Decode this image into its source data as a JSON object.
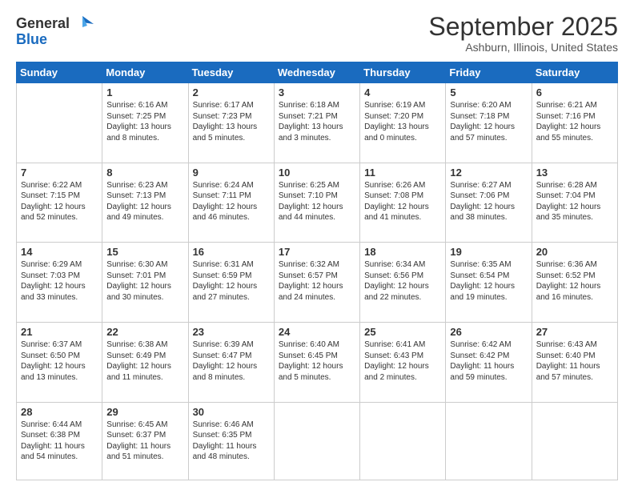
{
  "logo": {
    "general": "General",
    "blue": "Blue"
  },
  "header": {
    "title": "September 2025",
    "subtitle": "Ashburn, Illinois, United States"
  },
  "days_of_week": [
    "Sunday",
    "Monday",
    "Tuesday",
    "Wednesday",
    "Thursday",
    "Friday",
    "Saturday"
  ],
  "weeks": [
    [
      {
        "day": "",
        "info": ""
      },
      {
        "day": "1",
        "info": "Sunrise: 6:16 AM\nSunset: 7:25 PM\nDaylight: 13 hours\nand 8 minutes."
      },
      {
        "day": "2",
        "info": "Sunrise: 6:17 AM\nSunset: 7:23 PM\nDaylight: 13 hours\nand 5 minutes."
      },
      {
        "day": "3",
        "info": "Sunrise: 6:18 AM\nSunset: 7:21 PM\nDaylight: 13 hours\nand 3 minutes."
      },
      {
        "day": "4",
        "info": "Sunrise: 6:19 AM\nSunset: 7:20 PM\nDaylight: 13 hours\nand 0 minutes."
      },
      {
        "day": "5",
        "info": "Sunrise: 6:20 AM\nSunset: 7:18 PM\nDaylight: 12 hours\nand 57 minutes."
      },
      {
        "day": "6",
        "info": "Sunrise: 6:21 AM\nSunset: 7:16 PM\nDaylight: 12 hours\nand 55 minutes."
      }
    ],
    [
      {
        "day": "7",
        "info": "Sunrise: 6:22 AM\nSunset: 7:15 PM\nDaylight: 12 hours\nand 52 minutes."
      },
      {
        "day": "8",
        "info": "Sunrise: 6:23 AM\nSunset: 7:13 PM\nDaylight: 12 hours\nand 49 minutes."
      },
      {
        "day": "9",
        "info": "Sunrise: 6:24 AM\nSunset: 7:11 PM\nDaylight: 12 hours\nand 46 minutes."
      },
      {
        "day": "10",
        "info": "Sunrise: 6:25 AM\nSunset: 7:10 PM\nDaylight: 12 hours\nand 44 minutes."
      },
      {
        "day": "11",
        "info": "Sunrise: 6:26 AM\nSunset: 7:08 PM\nDaylight: 12 hours\nand 41 minutes."
      },
      {
        "day": "12",
        "info": "Sunrise: 6:27 AM\nSunset: 7:06 PM\nDaylight: 12 hours\nand 38 minutes."
      },
      {
        "day": "13",
        "info": "Sunrise: 6:28 AM\nSunset: 7:04 PM\nDaylight: 12 hours\nand 35 minutes."
      }
    ],
    [
      {
        "day": "14",
        "info": "Sunrise: 6:29 AM\nSunset: 7:03 PM\nDaylight: 12 hours\nand 33 minutes."
      },
      {
        "day": "15",
        "info": "Sunrise: 6:30 AM\nSunset: 7:01 PM\nDaylight: 12 hours\nand 30 minutes."
      },
      {
        "day": "16",
        "info": "Sunrise: 6:31 AM\nSunset: 6:59 PM\nDaylight: 12 hours\nand 27 minutes."
      },
      {
        "day": "17",
        "info": "Sunrise: 6:32 AM\nSunset: 6:57 PM\nDaylight: 12 hours\nand 24 minutes."
      },
      {
        "day": "18",
        "info": "Sunrise: 6:34 AM\nSunset: 6:56 PM\nDaylight: 12 hours\nand 22 minutes."
      },
      {
        "day": "19",
        "info": "Sunrise: 6:35 AM\nSunset: 6:54 PM\nDaylight: 12 hours\nand 19 minutes."
      },
      {
        "day": "20",
        "info": "Sunrise: 6:36 AM\nSunset: 6:52 PM\nDaylight: 12 hours\nand 16 minutes."
      }
    ],
    [
      {
        "day": "21",
        "info": "Sunrise: 6:37 AM\nSunset: 6:50 PM\nDaylight: 12 hours\nand 13 minutes."
      },
      {
        "day": "22",
        "info": "Sunrise: 6:38 AM\nSunset: 6:49 PM\nDaylight: 12 hours\nand 11 minutes."
      },
      {
        "day": "23",
        "info": "Sunrise: 6:39 AM\nSunset: 6:47 PM\nDaylight: 12 hours\nand 8 minutes."
      },
      {
        "day": "24",
        "info": "Sunrise: 6:40 AM\nSunset: 6:45 PM\nDaylight: 12 hours\nand 5 minutes."
      },
      {
        "day": "25",
        "info": "Sunrise: 6:41 AM\nSunset: 6:43 PM\nDaylight: 12 hours\nand 2 minutes."
      },
      {
        "day": "26",
        "info": "Sunrise: 6:42 AM\nSunset: 6:42 PM\nDaylight: 11 hours\nand 59 minutes."
      },
      {
        "day": "27",
        "info": "Sunrise: 6:43 AM\nSunset: 6:40 PM\nDaylight: 11 hours\nand 57 minutes."
      }
    ],
    [
      {
        "day": "28",
        "info": "Sunrise: 6:44 AM\nSunset: 6:38 PM\nDaylight: 11 hours\nand 54 minutes."
      },
      {
        "day": "29",
        "info": "Sunrise: 6:45 AM\nSunset: 6:37 PM\nDaylight: 11 hours\nand 51 minutes."
      },
      {
        "day": "30",
        "info": "Sunrise: 6:46 AM\nSunset: 6:35 PM\nDaylight: 11 hours\nand 48 minutes."
      },
      {
        "day": "",
        "info": ""
      },
      {
        "day": "",
        "info": ""
      },
      {
        "day": "",
        "info": ""
      },
      {
        "day": "",
        "info": ""
      }
    ]
  ]
}
